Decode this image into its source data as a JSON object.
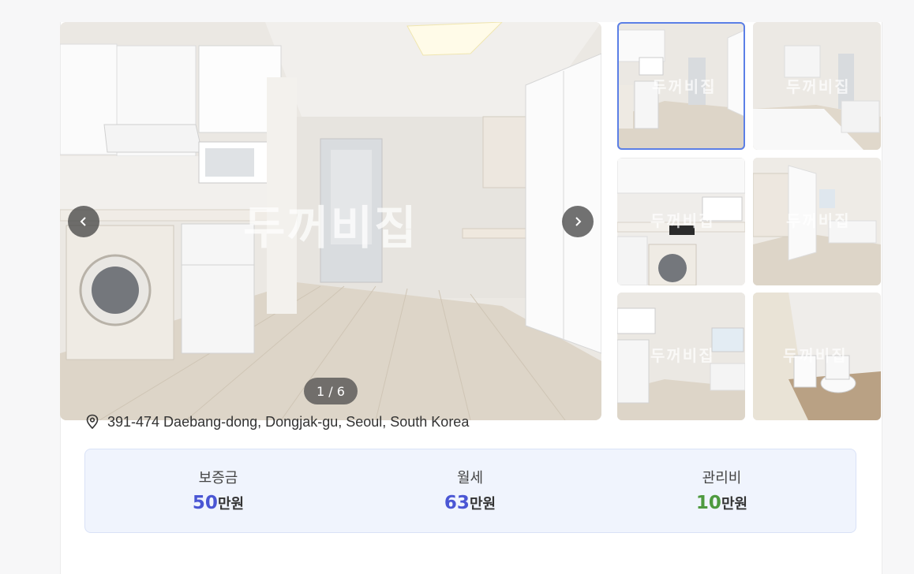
{
  "gallery": {
    "counter": "1 / 6",
    "watermark": "두꺼비집",
    "prev_icon": "chevron-left-icon",
    "next_icon": "chevron-right-icon",
    "active_index": 0
  },
  "address": {
    "icon": "location-pin-icon",
    "text": "391-474 Daebang-dong, Dongjak-gu, Seoul, South Korea"
  },
  "prices": [
    {
      "label": "보증금",
      "value": "50",
      "unit": "만원",
      "color": "#4a56d4"
    },
    {
      "label": "월세",
      "value": "63",
      "unit": "만원",
      "color": "#4a56d4"
    },
    {
      "label": "관리비",
      "value": "10",
      "unit": "만원",
      "color": "#4e9a3f"
    }
  ],
  "colors": {
    "accent": "#5b7fe6",
    "price_box_bg": "#f0f4fd"
  }
}
